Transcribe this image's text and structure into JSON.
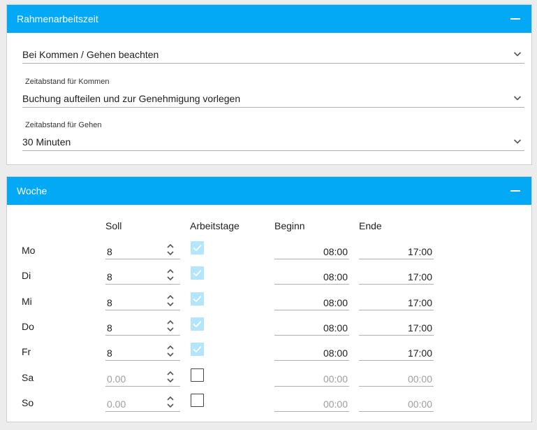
{
  "rahmen": {
    "title": "Rahmenarbeitszeit",
    "mode_value": "Bei Kommen / Gehen beachten",
    "kommen_label": "Zeitabstand für Kommen",
    "kommen_value": "Buchung aufteilen und zur Genehmigung vorlegen",
    "gehen_label": "Zeitabstand für Gehen",
    "gehen_value": "30 Minuten"
  },
  "woche": {
    "title": "Woche",
    "columns": {
      "soll": "Soll",
      "arbeitstage": "Arbeitstage",
      "beginn": "Beginn",
      "ende": "Ende"
    },
    "rows": [
      {
        "day": "Mo",
        "soll": "8",
        "soll_placeholder": false,
        "checked": true,
        "begin": "08:00",
        "end": "17:00",
        "time_placeholder": false
      },
      {
        "day": "Di",
        "soll": "8",
        "soll_placeholder": false,
        "checked": true,
        "begin": "08:00",
        "end": "17:00",
        "time_placeholder": false
      },
      {
        "day": "Mi",
        "soll": "8",
        "soll_placeholder": false,
        "checked": true,
        "begin": "08:00",
        "end": "17:00",
        "time_placeholder": false
      },
      {
        "day": "Do",
        "soll": "8",
        "soll_placeholder": false,
        "checked": true,
        "begin": "08:00",
        "end": "17:00",
        "time_placeholder": false
      },
      {
        "day": "Fr",
        "soll": "8",
        "soll_placeholder": false,
        "checked": true,
        "begin": "08:00",
        "end": "17:00",
        "time_placeholder": false
      },
      {
        "day": "Sa",
        "soll": "0.00",
        "soll_placeholder": true,
        "checked": false,
        "begin": "00:00",
        "end": "00:00",
        "time_placeholder": true
      },
      {
        "day": "So",
        "soll": "0.00",
        "soll_placeholder": true,
        "checked": false,
        "begin": "00:00",
        "end": "00:00",
        "time_placeholder": true
      }
    ]
  },
  "colors": {
    "header": "#03a9f4",
    "checked_fill": "#b3e5fc"
  },
  "icons": {
    "collapse": "minus-icon",
    "select": "chevron-down-icon",
    "spinner": "up-down-chevron-icon",
    "checkbox": "check-icon"
  }
}
